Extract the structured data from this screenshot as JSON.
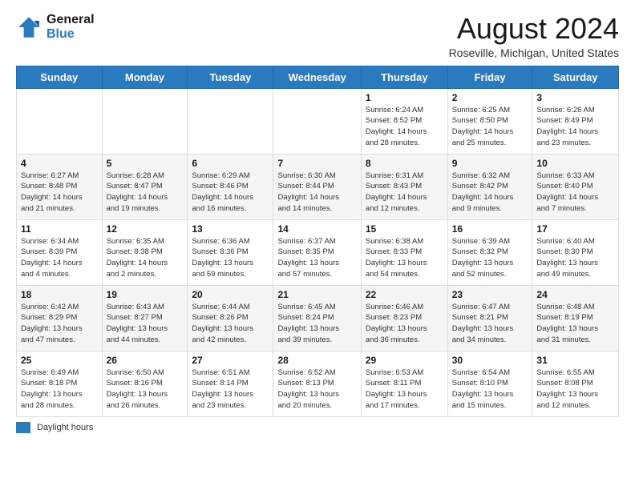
{
  "logo": {
    "line1": "General",
    "line2": "Blue"
  },
  "title": "August 2024",
  "subtitle": "Roseville, Michigan, United States",
  "days_of_week": [
    "Sunday",
    "Monday",
    "Tuesday",
    "Wednesday",
    "Thursday",
    "Friday",
    "Saturday"
  ],
  "footer": {
    "legend_label": "Daylight hours"
  },
  "weeks": [
    [
      {
        "day": "",
        "info": ""
      },
      {
        "day": "",
        "info": ""
      },
      {
        "day": "",
        "info": ""
      },
      {
        "day": "",
        "info": ""
      },
      {
        "day": "1",
        "info": "Sunrise: 6:24 AM\nSunset: 8:52 PM\nDaylight: 14 hours\nand 28 minutes."
      },
      {
        "day": "2",
        "info": "Sunrise: 6:25 AM\nSunset: 8:50 PM\nDaylight: 14 hours\nand 25 minutes."
      },
      {
        "day": "3",
        "info": "Sunrise: 6:26 AM\nSunset: 8:49 PM\nDaylight: 14 hours\nand 23 minutes."
      }
    ],
    [
      {
        "day": "4",
        "info": "Sunrise: 6:27 AM\nSunset: 8:48 PM\nDaylight: 14 hours\nand 21 minutes."
      },
      {
        "day": "5",
        "info": "Sunrise: 6:28 AM\nSunset: 8:47 PM\nDaylight: 14 hours\nand 19 minutes."
      },
      {
        "day": "6",
        "info": "Sunrise: 6:29 AM\nSunset: 8:46 PM\nDaylight: 14 hours\nand 16 minutes."
      },
      {
        "day": "7",
        "info": "Sunrise: 6:30 AM\nSunset: 8:44 PM\nDaylight: 14 hours\nand 14 minutes."
      },
      {
        "day": "8",
        "info": "Sunrise: 6:31 AM\nSunset: 8:43 PM\nDaylight: 14 hours\nand 12 minutes."
      },
      {
        "day": "9",
        "info": "Sunrise: 6:32 AM\nSunset: 8:42 PM\nDaylight: 14 hours\nand 9 minutes."
      },
      {
        "day": "10",
        "info": "Sunrise: 6:33 AM\nSunset: 8:40 PM\nDaylight: 14 hours\nand 7 minutes."
      }
    ],
    [
      {
        "day": "11",
        "info": "Sunrise: 6:34 AM\nSunset: 8:39 PM\nDaylight: 14 hours\nand 4 minutes."
      },
      {
        "day": "12",
        "info": "Sunrise: 6:35 AM\nSunset: 8:38 PM\nDaylight: 14 hours\nand 2 minutes."
      },
      {
        "day": "13",
        "info": "Sunrise: 6:36 AM\nSunset: 8:36 PM\nDaylight: 13 hours\nand 59 minutes."
      },
      {
        "day": "14",
        "info": "Sunrise: 6:37 AM\nSunset: 8:35 PM\nDaylight: 13 hours\nand 57 minutes."
      },
      {
        "day": "15",
        "info": "Sunrise: 6:38 AM\nSunset: 8:33 PM\nDaylight: 13 hours\nand 54 minutes."
      },
      {
        "day": "16",
        "info": "Sunrise: 6:39 AM\nSunset: 8:32 PM\nDaylight: 13 hours\nand 52 minutes."
      },
      {
        "day": "17",
        "info": "Sunrise: 6:40 AM\nSunset: 8:30 PM\nDaylight: 13 hours\nand 49 minutes."
      }
    ],
    [
      {
        "day": "18",
        "info": "Sunrise: 6:42 AM\nSunset: 8:29 PM\nDaylight: 13 hours\nand 47 minutes."
      },
      {
        "day": "19",
        "info": "Sunrise: 6:43 AM\nSunset: 8:27 PM\nDaylight: 13 hours\nand 44 minutes."
      },
      {
        "day": "20",
        "info": "Sunrise: 6:44 AM\nSunset: 8:26 PM\nDaylight: 13 hours\nand 42 minutes."
      },
      {
        "day": "21",
        "info": "Sunrise: 6:45 AM\nSunset: 8:24 PM\nDaylight: 13 hours\nand 39 minutes."
      },
      {
        "day": "22",
        "info": "Sunrise: 6:46 AM\nSunset: 8:23 PM\nDaylight: 13 hours\nand 36 minutes."
      },
      {
        "day": "23",
        "info": "Sunrise: 6:47 AM\nSunset: 8:21 PM\nDaylight: 13 hours\nand 34 minutes."
      },
      {
        "day": "24",
        "info": "Sunrise: 6:48 AM\nSunset: 8:19 PM\nDaylight: 13 hours\nand 31 minutes."
      }
    ],
    [
      {
        "day": "25",
        "info": "Sunrise: 6:49 AM\nSunset: 8:18 PM\nDaylight: 13 hours\nand 28 minutes."
      },
      {
        "day": "26",
        "info": "Sunrise: 6:50 AM\nSunset: 8:16 PM\nDaylight: 13 hours\nand 26 minutes."
      },
      {
        "day": "27",
        "info": "Sunrise: 6:51 AM\nSunset: 8:14 PM\nDaylight: 13 hours\nand 23 minutes."
      },
      {
        "day": "28",
        "info": "Sunrise: 6:52 AM\nSunset: 8:13 PM\nDaylight: 13 hours\nand 20 minutes."
      },
      {
        "day": "29",
        "info": "Sunrise: 6:53 AM\nSunset: 8:11 PM\nDaylight: 13 hours\nand 17 minutes."
      },
      {
        "day": "30",
        "info": "Sunrise: 6:54 AM\nSunset: 8:10 PM\nDaylight: 13 hours\nand 15 minutes."
      },
      {
        "day": "31",
        "info": "Sunrise: 6:55 AM\nSunset: 8:08 PM\nDaylight: 13 hours\nand 12 minutes."
      }
    ]
  ]
}
